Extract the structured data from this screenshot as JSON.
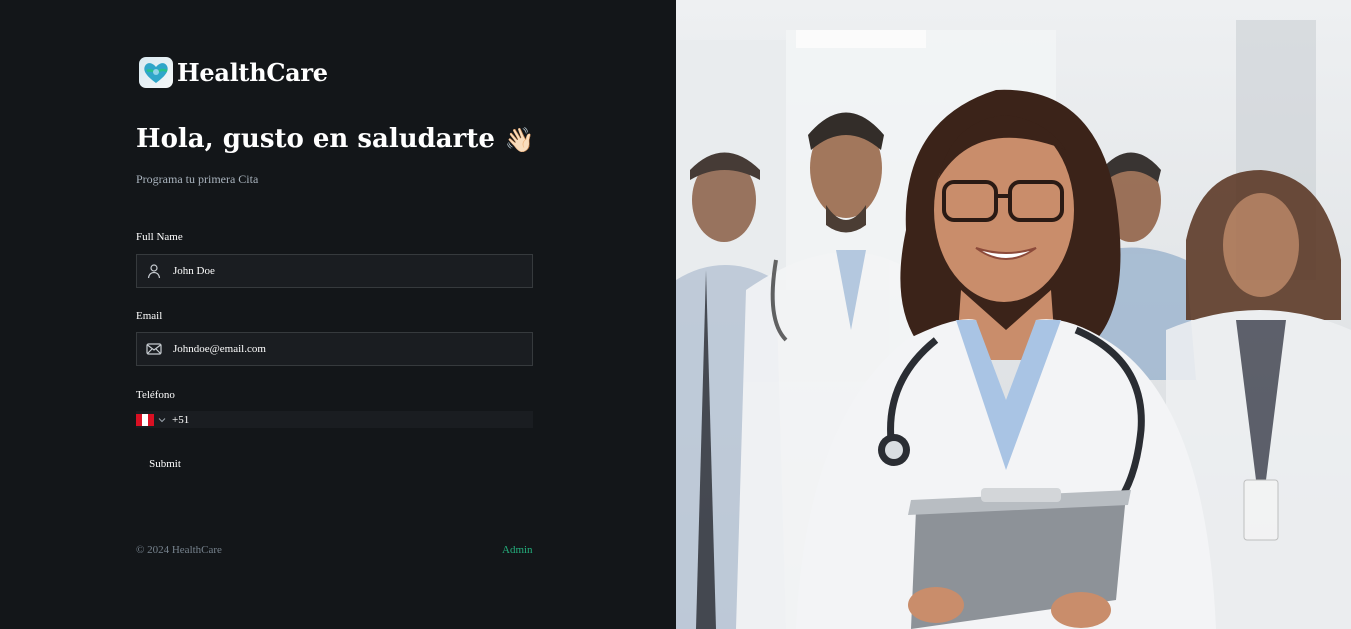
{
  "brand": {
    "name": "HealthCare"
  },
  "hero": {
    "title": "Hola, gusto en saludarte",
    "emoji": "👋🏻",
    "subtitle": "Programa tu primera Cita"
  },
  "form": {
    "full_name": {
      "label": "Full Name",
      "value": "John Doe",
      "icon": "user-icon"
    },
    "email": {
      "label": "Email",
      "value": "Johndoe@email.com",
      "icon": "envelope-icon"
    },
    "phone": {
      "label": "Teléfono",
      "country_code": "+51",
      "country": "PE",
      "icon": "peru-flag-icon"
    },
    "submit_label": "Submit"
  },
  "footer": {
    "copyright": "© 2024 HealthCare",
    "admin_link": "Admin"
  },
  "colors": {
    "background": "#131619",
    "field_background": "#1a1d21",
    "field_border": "#363a3d",
    "accent_green": "#24ae7c",
    "muted_text": "#76828d"
  },
  "image": {
    "subject": "doctors-photo"
  }
}
